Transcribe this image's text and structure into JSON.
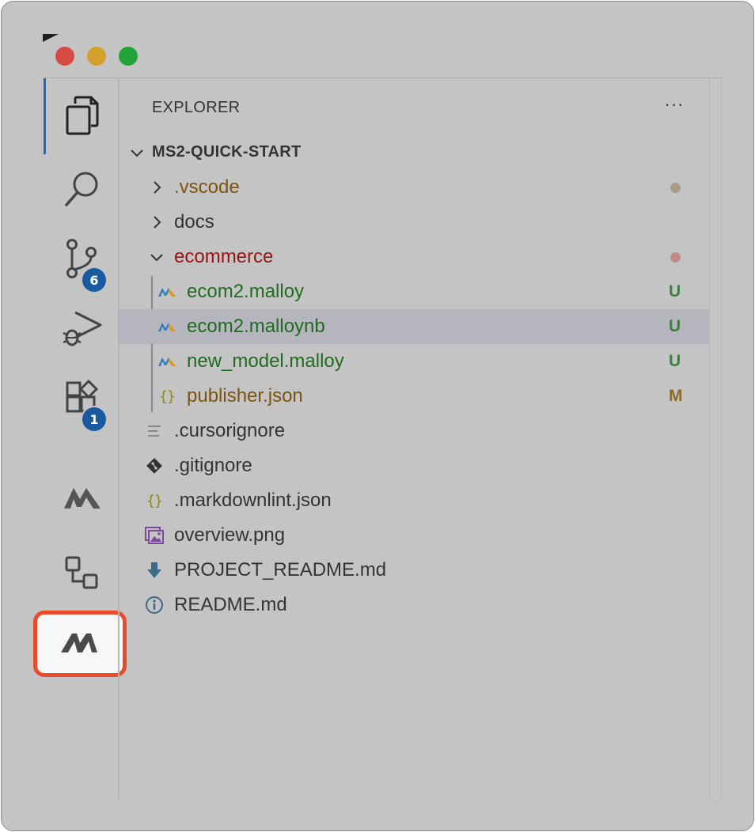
{
  "explorer": {
    "title": "EXPLORER",
    "more_actions": "···",
    "root": "MS2-QUICK-START",
    "items": [
      {
        "label": ".vscode",
        "type": "folder",
        "expanded": false,
        "color": "#7a5410",
        "status": "",
        "dot_color": "#a89a84"
      },
      {
        "label": "docs",
        "type": "folder",
        "expanded": false,
        "color": "#333333",
        "status": "",
        "dot_color": ""
      },
      {
        "label": "ecommerce",
        "type": "folder",
        "expanded": true,
        "color": "#9a1414",
        "status": "",
        "dot_color": "#c38a8a"
      },
      {
        "label": "ecom2.malloy",
        "type": "malloy-file",
        "color": "#1f6b1f",
        "status": "U",
        "status_color": "#3f7f3f"
      },
      {
        "label": "ecom2.malloynb",
        "type": "malloy-file",
        "color": "#1f6b1f",
        "status": "U",
        "status_color": "#3f7f3f",
        "selected": true
      },
      {
        "label": "new_model.malloy",
        "type": "malloy-file",
        "color": "#1f6b1f",
        "status": "U",
        "status_color": "#3f7f3f"
      },
      {
        "label": "publisher.json",
        "type": "json-file",
        "color": "#7a5410",
        "status": "M",
        "status_color": "#8a6a2a"
      },
      {
        "label": ".cursorignore",
        "type": "text-file",
        "color": "#333333"
      },
      {
        "label": ".gitignore",
        "type": "git-file",
        "color": "#333333"
      },
      {
        "label": ".markdownlint.json",
        "type": "json-file",
        "color": "#333333"
      },
      {
        "label": "overview.png",
        "type": "image-file",
        "color": "#333333"
      },
      {
        "label": "PROJECT_README.md",
        "type": "download-file",
        "color": "#333333"
      },
      {
        "label": "README.md",
        "type": "info-file",
        "color": "#333333"
      }
    ]
  },
  "activity_bar": {
    "items": [
      {
        "name": "explorer-icon",
        "active": true
      },
      {
        "name": "search-icon"
      },
      {
        "name": "source-control-icon",
        "badge": "6"
      },
      {
        "name": "run-debug-icon"
      },
      {
        "name": "extensions-icon",
        "badge": "1"
      },
      {
        "name": "malloy-icon"
      },
      {
        "name": "remote-explorer-icon"
      },
      {
        "name": "malloy-publisher-icon",
        "highlighted": true
      }
    ]
  },
  "colors": {
    "accent": "#2266c8",
    "badge": "#1a5a9e",
    "highlight_border": "#ea4b2b",
    "selected_row": "#b5b5bd"
  }
}
